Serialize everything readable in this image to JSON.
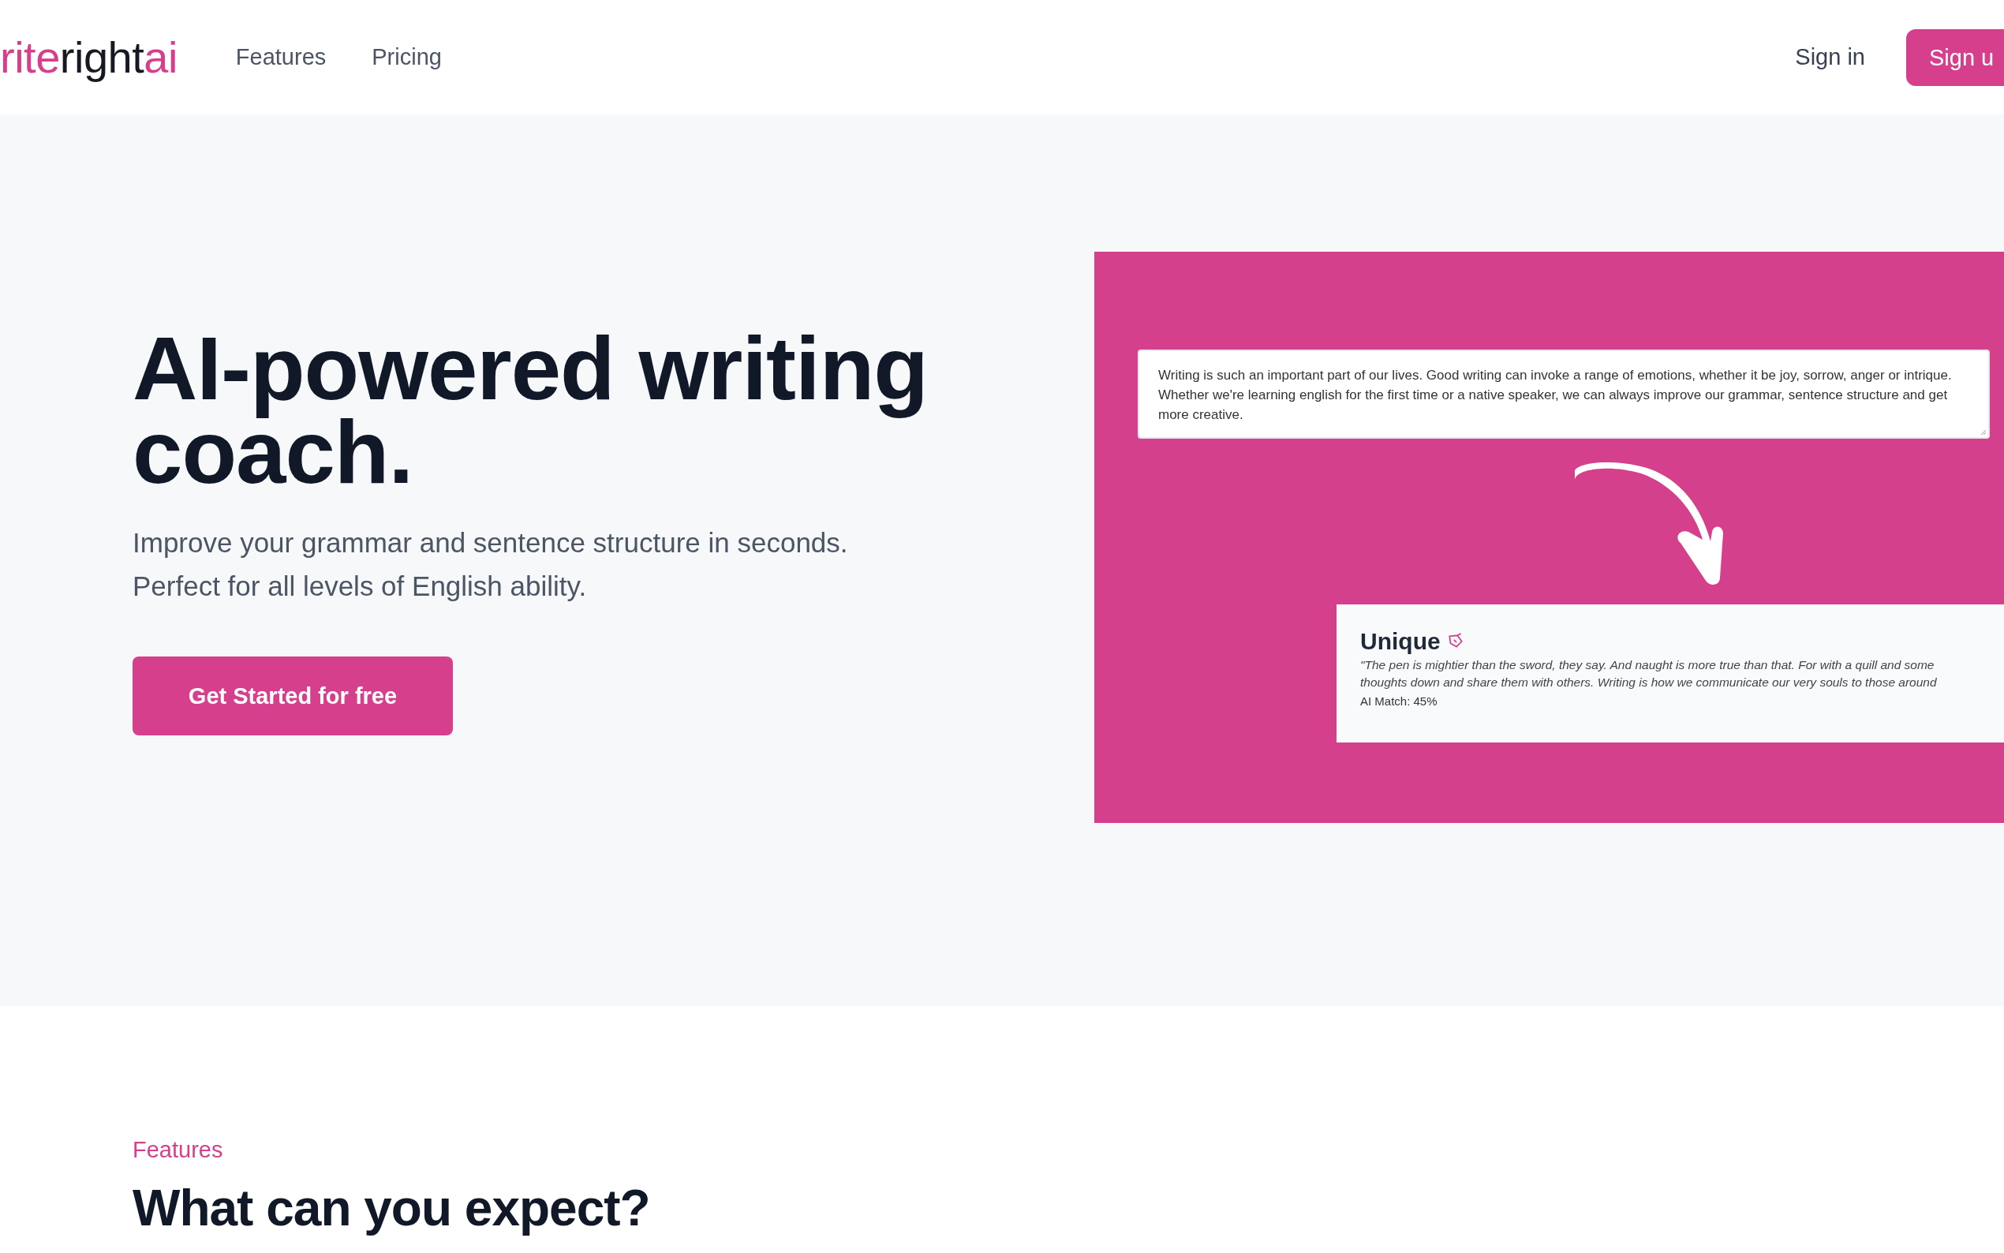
{
  "header": {
    "logo": [
      {
        "text": "rite",
        "kind": "accent"
      },
      {
        "text": "right",
        "kind": "plain"
      },
      {
        "text": "ai",
        "kind": "accent"
      }
    ],
    "nav": [
      "Features",
      "Pricing"
    ],
    "sign_in": "Sign in",
    "sign_up": "Sign u"
  },
  "hero": {
    "title": "AI-powered writing coach.",
    "subtitle": [
      "Improve your grammar and sentence structure in seconds.",
      "Perfect for all levels of English ability."
    ],
    "cta": "Get Started for free",
    "demo": {
      "input_text": "Writing is such an important part of our lives. Good writing can invoke a range of emotions, whether it be joy, sorrow, anger or intrique. Whether we're learning english for the first time or a native speaker, we can always improve our grammar, sentence structure and get more creative.",
      "result_title": "Unique",
      "result_lines": [
        "\"The pen is mightier than the sword, they say. And naught is more true than that. For with a quill and some",
        "thoughts down and share them with others. Writing is how we communicate our very souls to those around"
      ],
      "result_match": "AI Match: 45%"
    }
  },
  "features": {
    "eyebrow": "Features",
    "title": "What can you expect?"
  }
}
